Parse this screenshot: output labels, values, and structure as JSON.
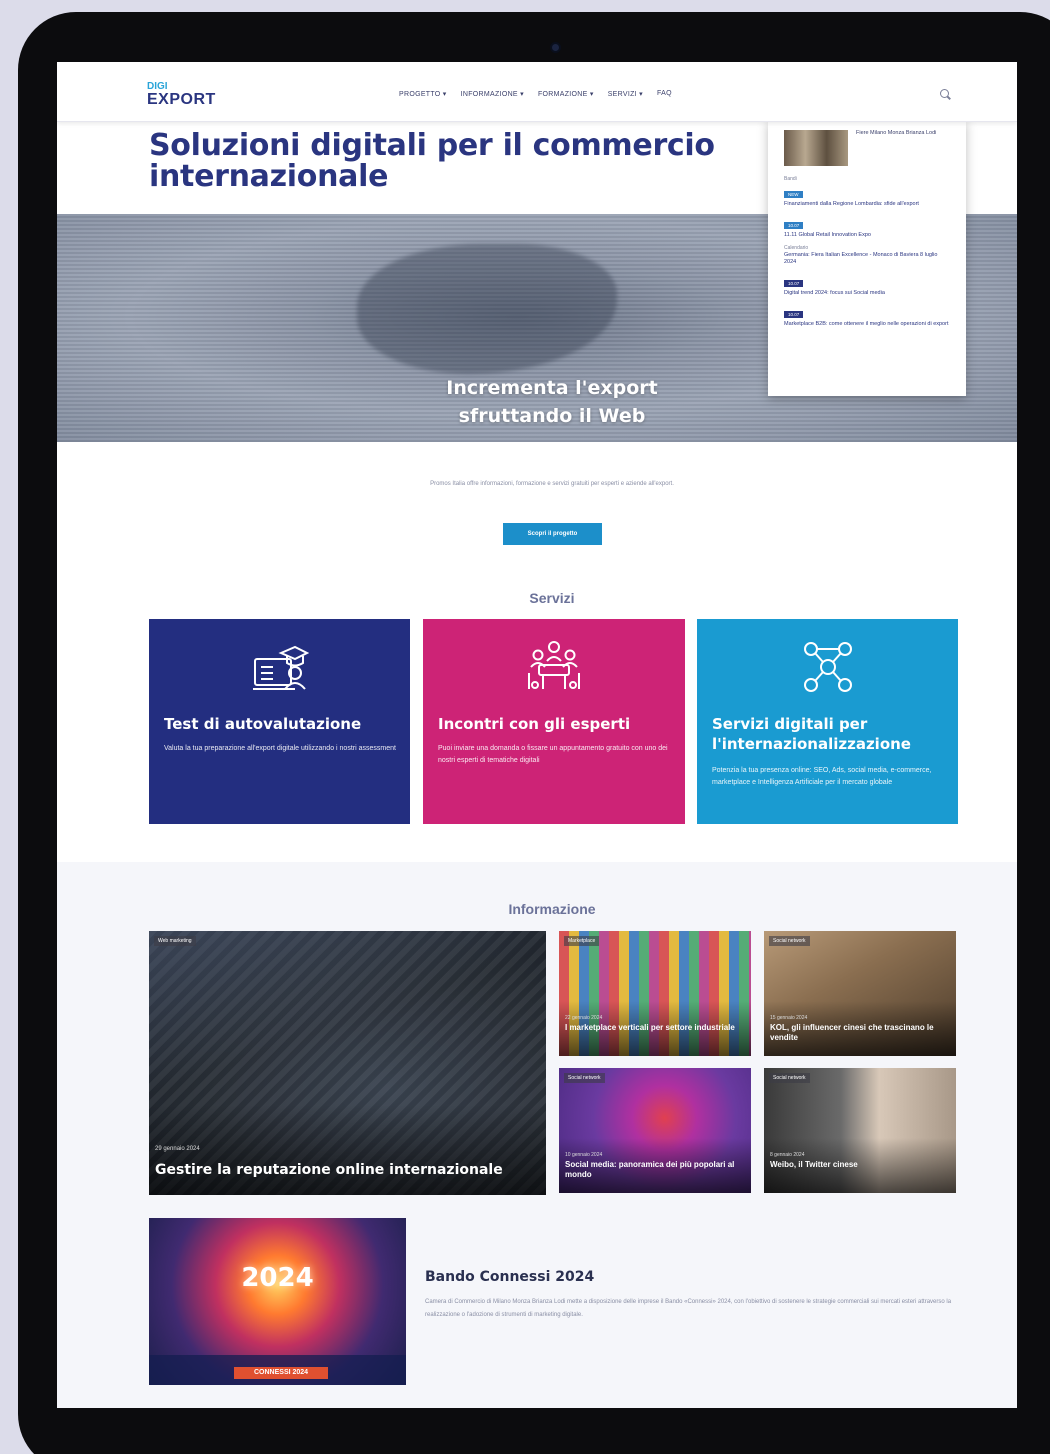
{
  "nav": {
    "logo_top": "DIGI",
    "logo_main": "EXPORT",
    "menu": [
      "PROGETTO ▾",
      "INFORMAZIONE ▾",
      "FORMAZIONE ▾",
      "SERVIZI ▾",
      "FAQ"
    ]
  },
  "hero": {
    "title": "Soluzioni digitali per il commercio internazionale",
    "slogan": "Incrementa l'export sfruttando il Web"
  },
  "news_panel": {
    "place": "Fiere Milano Monza Brianza Lodi",
    "entries": [
      {
        "category": "Bandi",
        "badge": "NEW",
        "text": "Finanziamenti dalla Regione Lombardia: sfide all'export"
      },
      {
        "category": "",
        "badge": "10.07",
        "text": "11.11 Global Retail Innovation Expo"
      },
      {
        "category": "Calendario",
        "badge": "",
        "text": "Germania: Fiera Italian Excellence - Monaco di Baviera 8 luglio 2024"
      },
      {
        "category": "",
        "badge": "10.07",
        "text": "Digital trend 2024: focus sui Social media"
      },
      {
        "category": "",
        "badge": "10.07",
        "text": "Marketplace B2B: come ottenere il meglio nelle operazioni di export"
      }
    ]
  },
  "intro": {
    "text": "Promos Italia offre informazioni, formazione e servizi gratuiti per esperti e aziende all'export.",
    "button": "Scopri il progetto"
  },
  "services": {
    "heading": "Servizi",
    "cards": [
      {
        "icon": "assessment-icon",
        "title": "Test di autovalutazione",
        "desc": "Valuta la tua preparazione all'export digitale utilizzando i nostri assessment",
        "color": "#232e80"
      },
      {
        "icon": "experts-meeting-icon",
        "title": "Incontri con gli esperti",
        "desc": "Puoi inviare una domanda o fissare un appuntamento gratuito con uno dei nostri esperti di tematiche digitali",
        "color": "#cd2376"
      },
      {
        "icon": "digital-network-icon",
        "title": "Servizi digitali per l'internazionalizzazione",
        "desc": "Potenzia la tua presenza online: SEO, Ads, social media, e-commerce, marketplace e Intelligenza Artificiale per il mercato globale",
        "color": "#1a9bd1"
      }
    ]
  },
  "information": {
    "heading": "Informazione",
    "main": {
      "tag": "Web marketing",
      "date": "29 gennaio 2024",
      "title": "Gestire la reputazione online internazionale"
    },
    "small": [
      {
        "tag": "Marketplace",
        "date": "22 gennaio 2024",
        "title": "I marketplace verticali per settore industriale"
      },
      {
        "tag": "Social network",
        "date": "15 gennaio 2024",
        "title": "KOL, gli influencer cinesi che trascinano le vendite"
      },
      {
        "tag": "Social network",
        "date": "10 gennaio 2024",
        "title": "Social media: panoramica dei più popolari al mondo"
      },
      {
        "tag": "Social network",
        "date": "8 gennaio 2024",
        "title": "Weibo, il Twitter cinese"
      }
    ]
  },
  "bando": {
    "year": "2024",
    "bar_label": "CONNESSI 2024",
    "title": "Bando Connessi 2024",
    "desc": "Camera di Commercio di Milano Monza Brianza Lodi mette a disposizione delle imprese il Bando «Connessi» 2024, con l'obiettivo di sostenere le strategie commerciali sui mercati esteri attraverso la realizzazione o l'adozione di strumenti di marketing digitale."
  }
}
